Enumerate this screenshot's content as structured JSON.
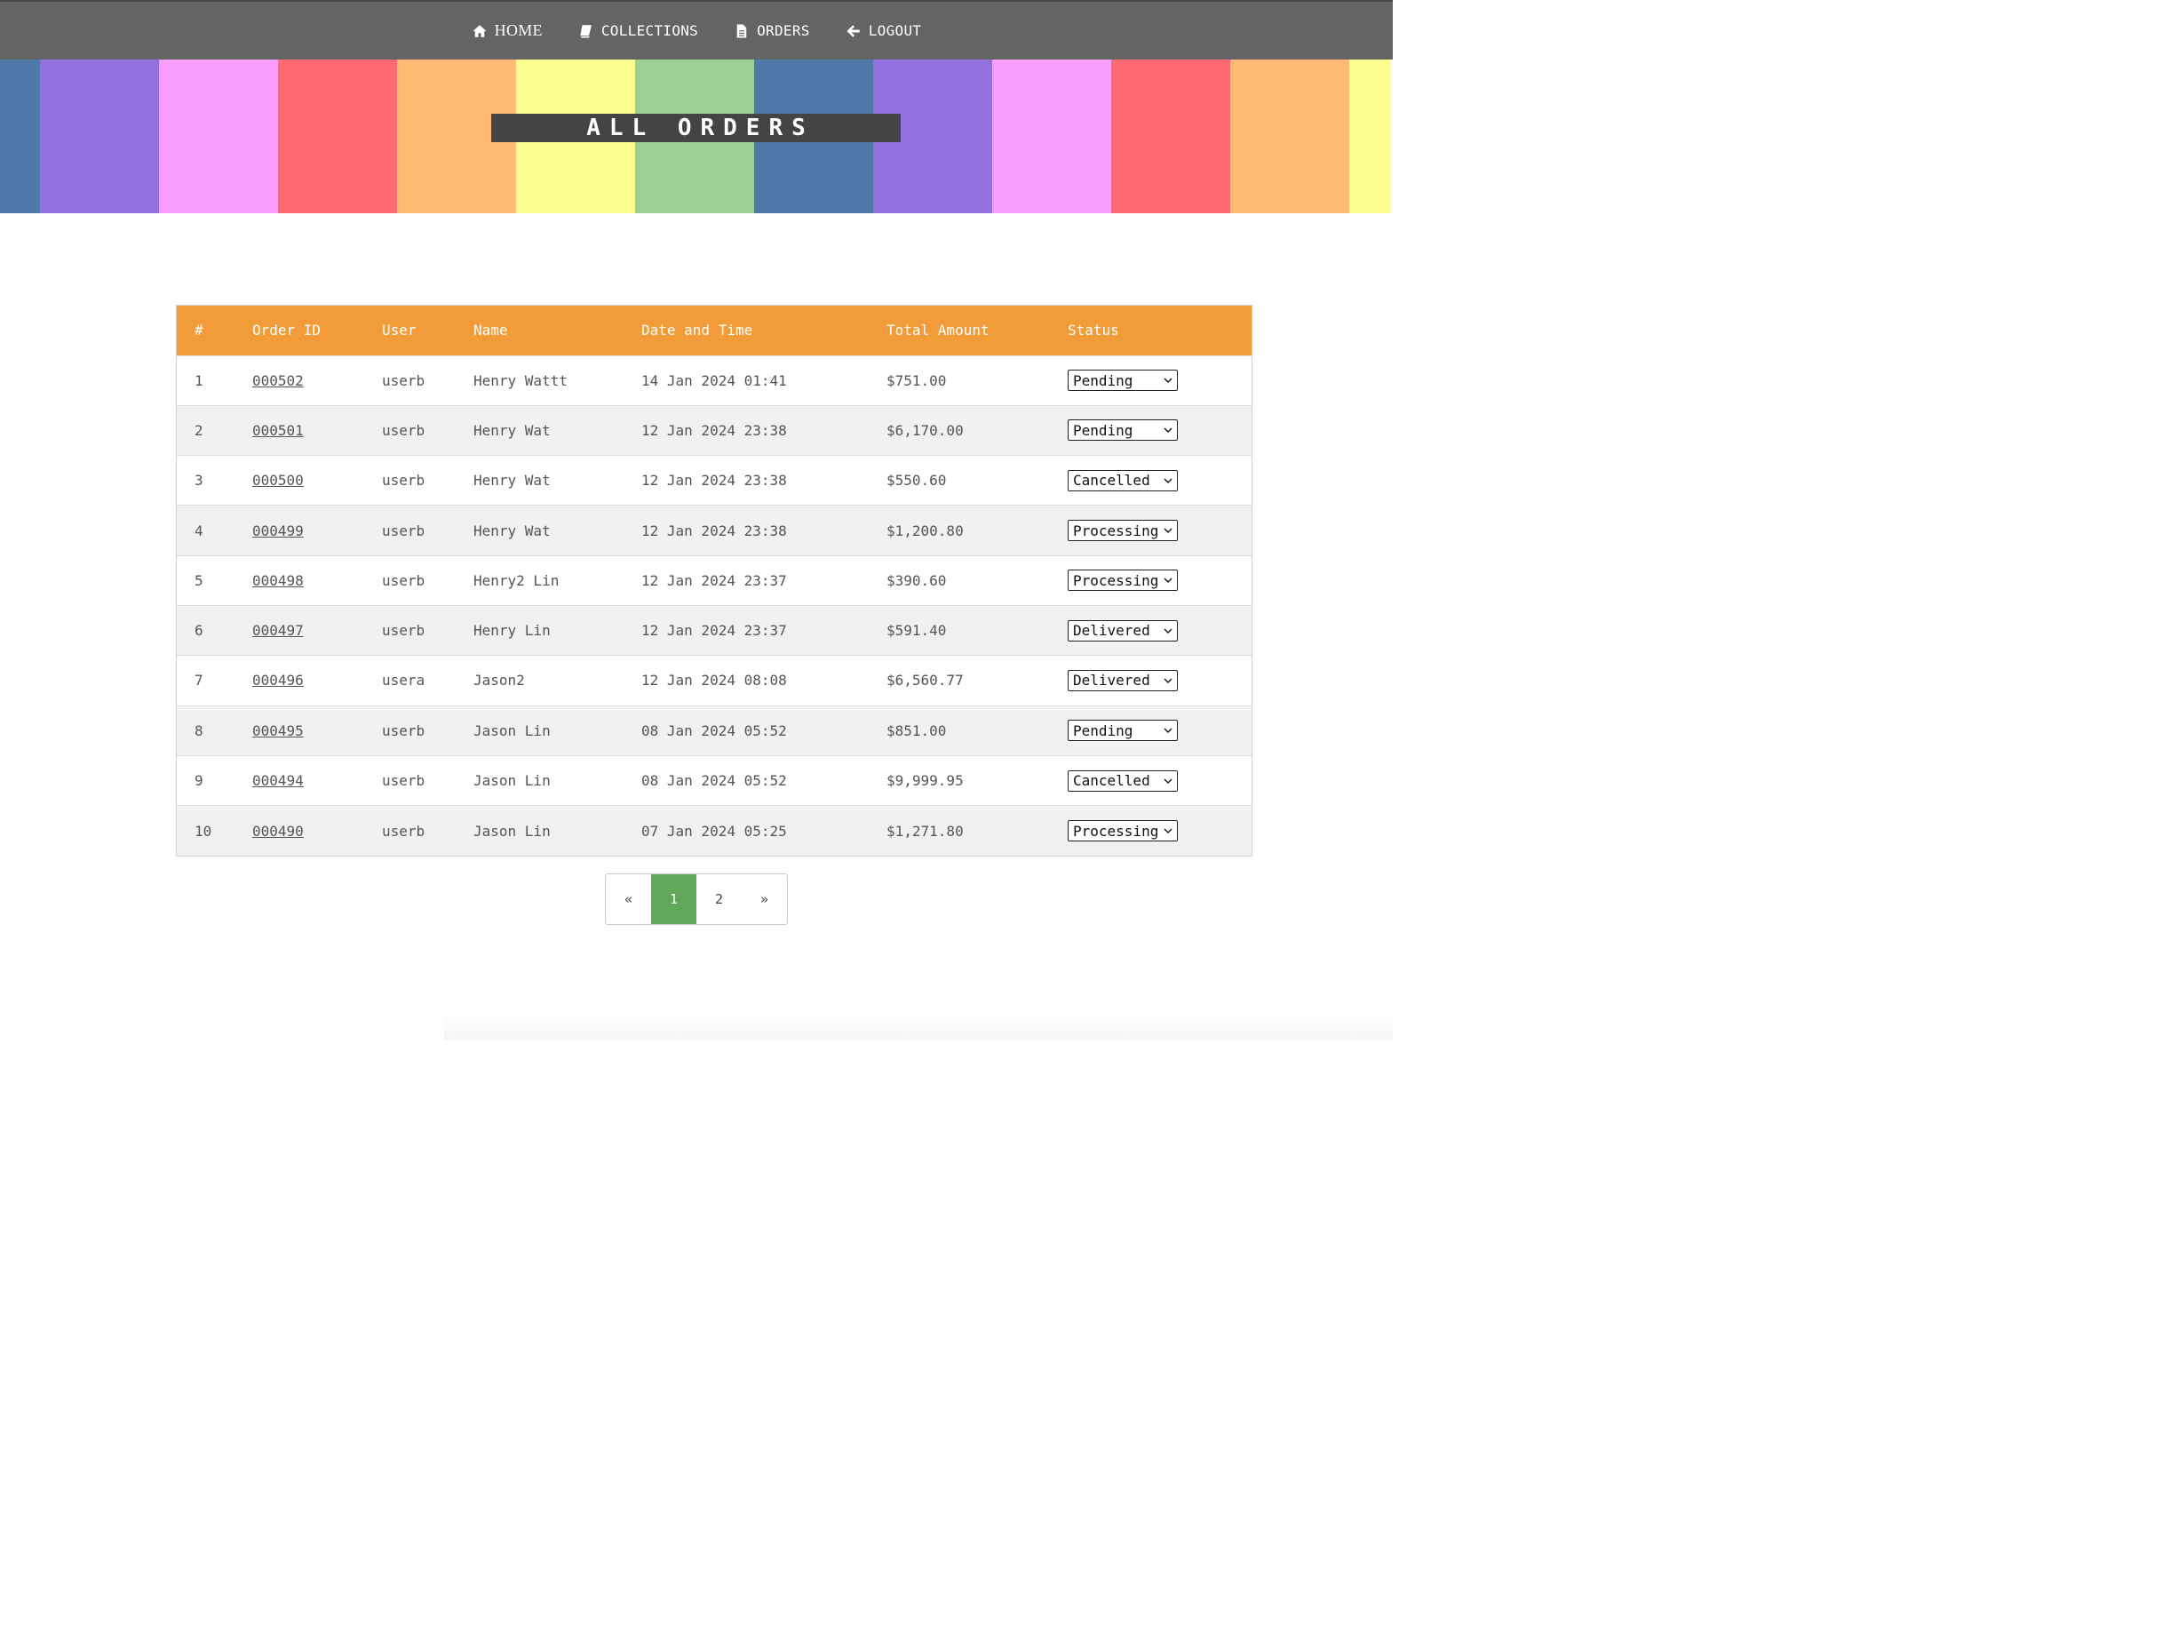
{
  "nav": {
    "items": [
      {
        "label": "HOME",
        "icon": "home-icon"
      },
      {
        "label": "COLLECTIONS",
        "icon": "book-icon"
      },
      {
        "label": "ORDERS",
        "icon": "file-icon"
      },
      {
        "label": "LOGOUT",
        "icon": "arrow-left-icon"
      }
    ]
  },
  "banner": {
    "title": "ALL ORDERS",
    "stripe_colors": [
      "#5078a8",
      "#9571e0",
      "#f99efb",
      "#ff6a72",
      "#ffbb72",
      "#fefe8e",
      "#9ed096",
      "#5078a8",
      "#9571e0",
      "#f99efb",
      "#ff6a72",
      "#ffbb72",
      "#fefe8e"
    ]
  },
  "table": {
    "headers": [
      "#",
      "Order ID",
      "User",
      "Name",
      "Date and Time",
      "Total Amount",
      "Status"
    ],
    "rows": [
      {
        "num": "1",
        "order_id": "000502",
        "user": "userb",
        "name": "Henry Wattt",
        "datetime": "14 Jan 2024 01:41",
        "total": "$751.00",
        "status": "Pending"
      },
      {
        "num": "2",
        "order_id": "000501",
        "user": "userb",
        "name": "Henry Wat",
        "datetime": "12 Jan 2024 23:38",
        "total": "$6,170.00",
        "status": "Pending"
      },
      {
        "num": "3",
        "order_id": "000500",
        "user": "userb",
        "name": "Henry Wat",
        "datetime": "12 Jan 2024 23:38",
        "total": "$550.60",
        "status": "Cancelled"
      },
      {
        "num": "4",
        "order_id": "000499",
        "user": "userb",
        "name": "Henry Wat",
        "datetime": "12 Jan 2024 23:38",
        "total": "$1,200.80",
        "status": "Processing"
      },
      {
        "num": "5",
        "order_id": "000498",
        "user": "userb",
        "name": "Henry2 Lin",
        "datetime": "12 Jan 2024 23:37",
        "total": "$390.60",
        "status": "Processing"
      },
      {
        "num": "6",
        "order_id": "000497",
        "user": "userb",
        "name": "Henry Lin",
        "datetime": "12 Jan 2024 23:37",
        "total": "$591.40",
        "status": "Delivered"
      },
      {
        "num": "7",
        "order_id": "000496",
        "user": "usera",
        "name": "Jason2",
        "datetime": "12 Jan 2024 08:08",
        "total": "$6,560.77",
        "status": "Delivered"
      },
      {
        "num": "8",
        "order_id": "000495",
        "user": "userb",
        "name": "Jason Lin",
        "datetime": "08 Jan 2024 05:52",
        "total": "$851.00",
        "status": "Pending"
      },
      {
        "num": "9",
        "order_id": "000494",
        "user": "userb",
        "name": "Jason Lin",
        "datetime": "08 Jan 2024 05:52",
        "total": "$9,999.95",
        "status": "Cancelled"
      },
      {
        "num": "10",
        "order_id": "000490",
        "user": "userb",
        "name": "Jason Lin",
        "datetime": "07 Jan 2024 05:25",
        "total": "$1,271.80",
        "status": "Processing"
      }
    ]
  },
  "pagination": {
    "prev": "«",
    "pages": [
      "1",
      "2"
    ],
    "current": "1",
    "next": "»"
  },
  "colors": {
    "nav_bg": "#646464",
    "header_bg": "#f19c38",
    "active_page": "#62a85a",
    "title_bg": "#444444"
  }
}
